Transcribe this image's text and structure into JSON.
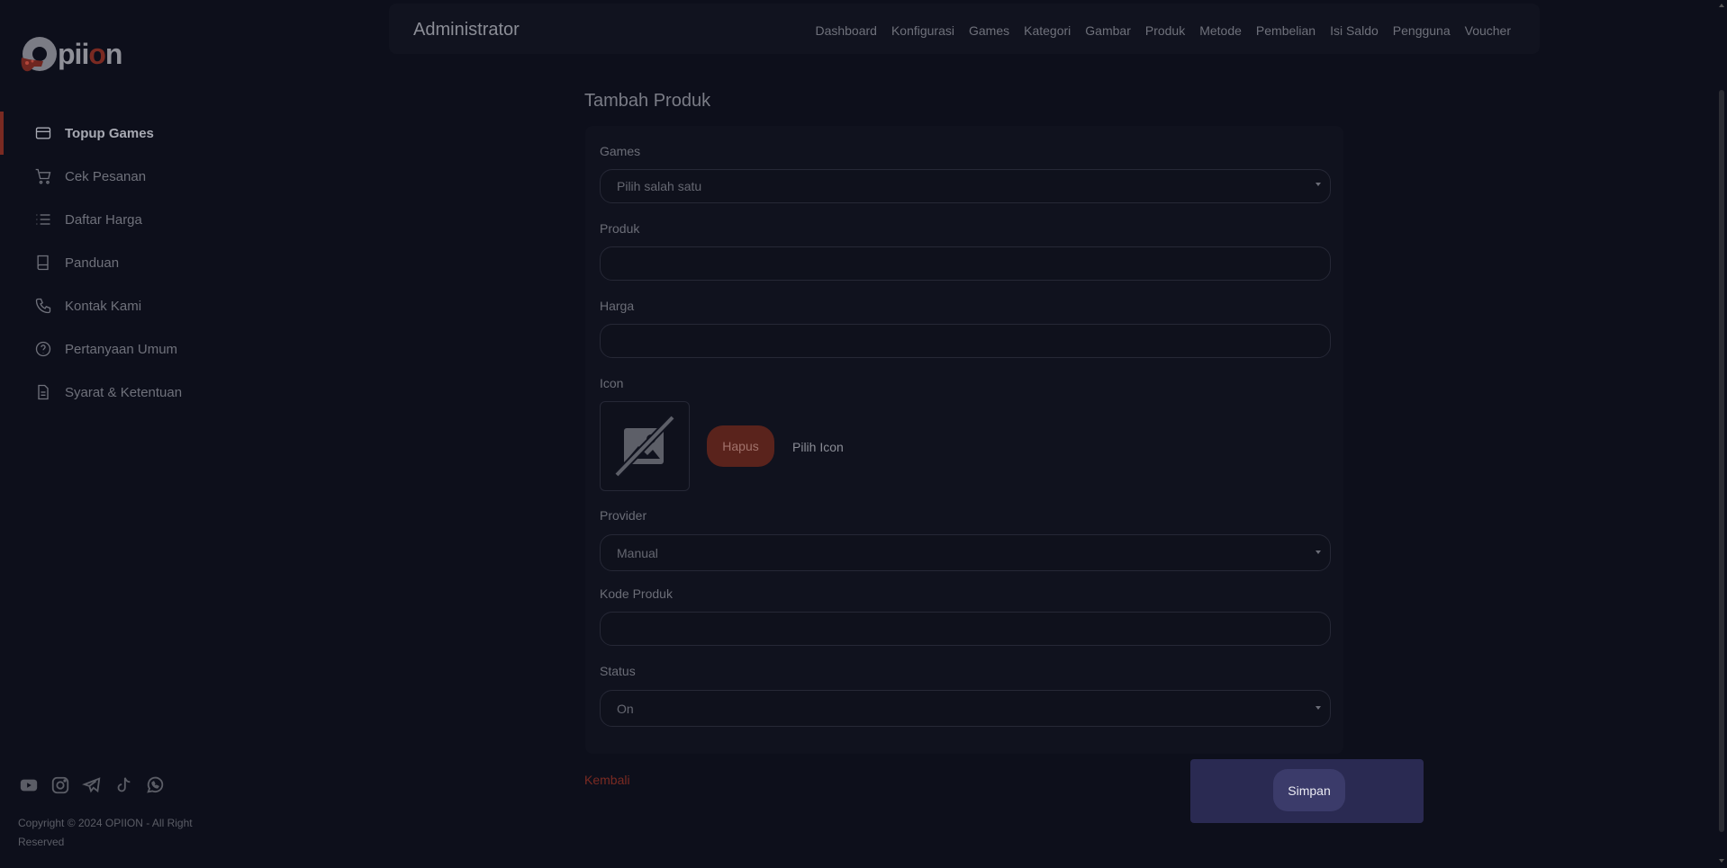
{
  "brand": {
    "logo_prefix": "p",
    "logo_name": "iion",
    "logo_o": "o",
    "logo_n": "n"
  },
  "sidebar": {
    "items": [
      {
        "label": "Topup Games",
        "icon": "credit-card-icon",
        "active": true
      },
      {
        "label": "Cek Pesanan",
        "icon": "cart-icon"
      },
      {
        "label": "Daftar Harga",
        "icon": "list-icon"
      },
      {
        "label": "Panduan",
        "icon": "book-icon"
      },
      {
        "label": "Kontak Kami",
        "icon": "phone-icon"
      },
      {
        "label": "Pertanyaan Umum",
        "icon": "question-icon"
      },
      {
        "label": "Syarat & Ketentuan",
        "icon": "document-icon"
      }
    ],
    "social": [
      "youtube-icon",
      "instagram-icon",
      "telegram-icon",
      "tiktok-icon",
      "whatsapp-icon"
    ],
    "copyright": "Copyright © 2024 OPIION - All Right Reserved"
  },
  "topbar": {
    "title": "Administrator",
    "menu": [
      "Dashboard",
      "Konfigurasi",
      "Games",
      "Kategori",
      "Gambar",
      "Produk",
      "Metode",
      "Pembelian",
      "Isi Saldo",
      "Pengguna",
      "Voucher"
    ]
  },
  "form": {
    "heading": "Tambah Produk",
    "games_label": "Games",
    "games_value": "Pilih salah satu",
    "produk_label": "Produk",
    "produk_value": "",
    "harga_label": "Harga",
    "harga_value": "",
    "icon_label": "Icon",
    "hapus_label": "Hapus",
    "pilih_icon_label": "Pilih Icon",
    "provider_label": "Provider",
    "provider_value": "Manual",
    "kode_label": "Kode Produk",
    "kode_value": "",
    "status_label": "Status",
    "status_value": "On",
    "kembali_label": "Kembali",
    "simpan_label": "Simpan"
  },
  "colors": {
    "accent": "#7a2a22",
    "dialog": "#2a2a52",
    "background": "#0d0f1b"
  }
}
